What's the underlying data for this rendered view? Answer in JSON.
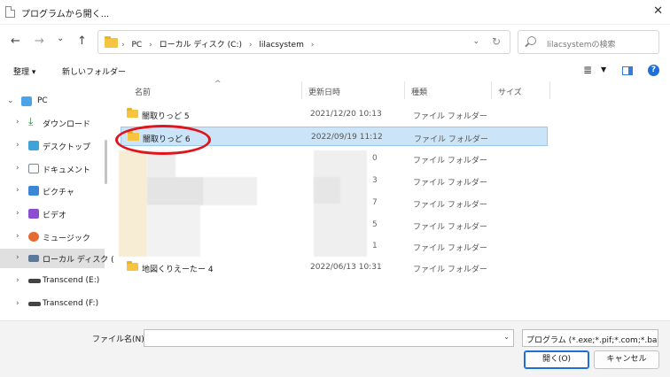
{
  "window": {
    "title": "プログラムから開く..."
  },
  "navigation": {
    "back_icon": "←",
    "forward_icon": "→",
    "recent_icon": "⌄",
    "up_icon": "↑"
  },
  "address": {
    "crumbs": [
      "PC",
      "ローカル ディスク (C:)",
      "lilacsystem"
    ],
    "separator": "›"
  },
  "search": {
    "placeholder": "lilacsystemの検索"
  },
  "toolbar": {
    "organize": "整理 ▾",
    "new_folder": "新しいフォルダー"
  },
  "sidebar": {
    "items": [
      {
        "label": "PC",
        "icon": "pc-icon"
      },
      {
        "label": "ダウンロード",
        "icon": "download-icon"
      },
      {
        "label": "デスクトップ",
        "icon": "desktop-icon"
      },
      {
        "label": "ドキュメント",
        "icon": "documents-icon"
      },
      {
        "label": "ピクチャ",
        "icon": "pictures-icon"
      },
      {
        "label": "ビデオ",
        "icon": "videos-icon"
      },
      {
        "label": "ミュージック",
        "icon": "music-icon"
      },
      {
        "label": "ローカル ディスク (",
        "icon": "local-disk-icon"
      },
      {
        "label": "Transcend (E:)",
        "icon": "usb-drive-icon"
      },
      {
        "label": "Transcend (F:)",
        "icon": "usb-drive-icon"
      }
    ]
  },
  "columns": [
    "名前",
    "更新日時",
    "種類",
    "サイズ"
  ],
  "files": [
    {
      "name": "闇取りっど 5",
      "date": "2021/12/20 10:13",
      "type": "ファイル フォルダー"
    },
    {
      "name": "闇取りっど 6",
      "date": "2022/09/19 11:12",
      "type": "ファイル フォルダー"
    },
    {
      "frag": "0",
      "type": "ファイル フォルダー"
    },
    {
      "frag": "3",
      "type": "ファイル フォルダー"
    },
    {
      "frag": "7",
      "type": "ファイル フォルダー"
    },
    {
      "frag": "5",
      "type": "ファイル フォルダー"
    },
    {
      "frag": "1",
      "type": "ファイル フォルダー"
    },
    {
      "name": "地図くりえーたー 4",
      "date": "2022/06/13 10:31",
      "type": "ファイル フォルダー"
    }
  ],
  "footer": {
    "filename_label": "ファイル名(N):",
    "filename_value": "",
    "filter": "プログラム (*.exe;*.pif;*.com;*.bat",
    "open": "開く(O)",
    "cancel": "キャンセル"
  },
  "colors": {
    "selection": "#cce4f7",
    "annotation": "#e0141e",
    "accent": "#1e6fd9"
  }
}
